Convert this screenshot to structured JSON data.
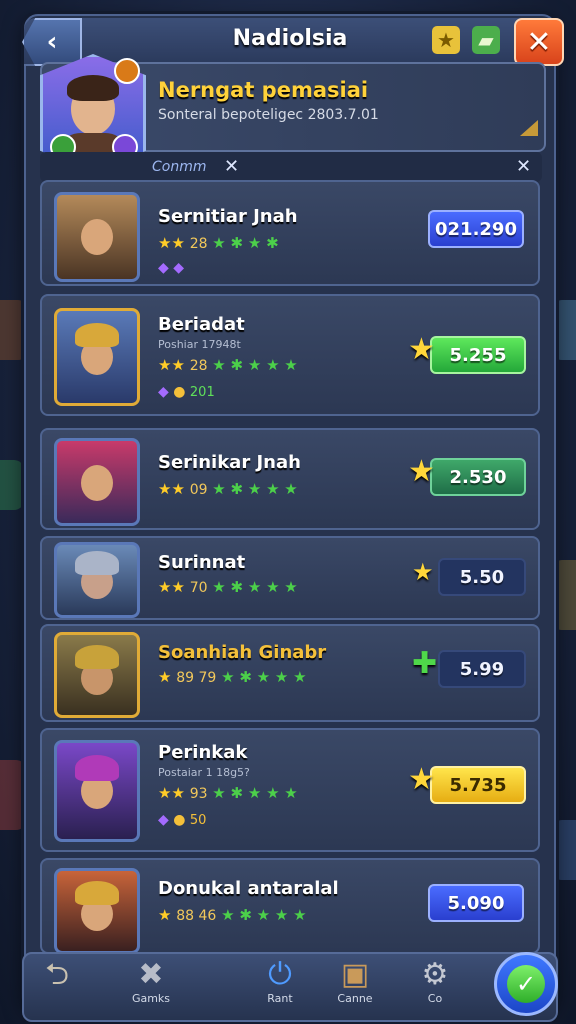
{
  "header": {
    "title": "Nadiolsia",
    "back_icon": "‹",
    "close_icon": "✕",
    "icon_star": "★",
    "icon_map": "▰"
  },
  "profile": {
    "name": "Nerngat pemasiai",
    "subtitle": "Sonteral bepoteligec 2803.7.01"
  },
  "tabs": {
    "label": "Conmm",
    "close_icon": "✕"
  },
  "cards": [
    {
      "name": "Sernitiar Jnah",
      "sub": "",
      "stars_num": "28",
      "price": "021.290",
      "price_style": "blue",
      "price_icon": "",
      "gem_text": ""
    },
    {
      "name": "Beriadat",
      "sub": "Poshiar 17948t",
      "stars_num": "28",
      "price": "5.255",
      "price_style": "green",
      "price_icon": "★",
      "gem_text": "201"
    },
    {
      "name": "Serinikar Jnah",
      "sub": "",
      "stars_num": "09",
      "price": "2.530",
      "price_style": "teal",
      "price_icon": "★",
      "gem_text": ""
    },
    {
      "name": "Surinnat",
      "sub": "",
      "stars_num": "70",
      "price": "5.50",
      "price_style": "navy",
      "price_icon": "★",
      "gem_text": ""
    },
    {
      "name": "Soanhiah Ginabr",
      "sub": "",
      "stars_num": "89 79",
      "price": "5.99",
      "price_style": "navy",
      "price_icon": "✚",
      "gem_text": ""
    },
    {
      "name": "Perinkak",
      "sub": "Postaiar 1 18g5?",
      "stars_num": "93",
      "price": "5.735",
      "price_style": "yellow",
      "price_icon": "★",
      "gem_text": "50"
    },
    {
      "name": "Donukal antaralal",
      "sub": "",
      "stars_num": "88 46",
      "price": "5.090",
      "price_style": "blue",
      "price_icon": "",
      "gem_text": ""
    }
  ],
  "bottom_nav": [
    {
      "label": "",
      "icon": "⮌"
    },
    {
      "label": "Gamks",
      "icon": "✖"
    },
    {
      "label": "Rant",
      "icon": "⏻"
    },
    {
      "label": "Canne",
      "icon": "▣"
    },
    {
      "label": "Co",
      "icon": "⚙"
    }
  ],
  "confirm_icon": "✓"
}
